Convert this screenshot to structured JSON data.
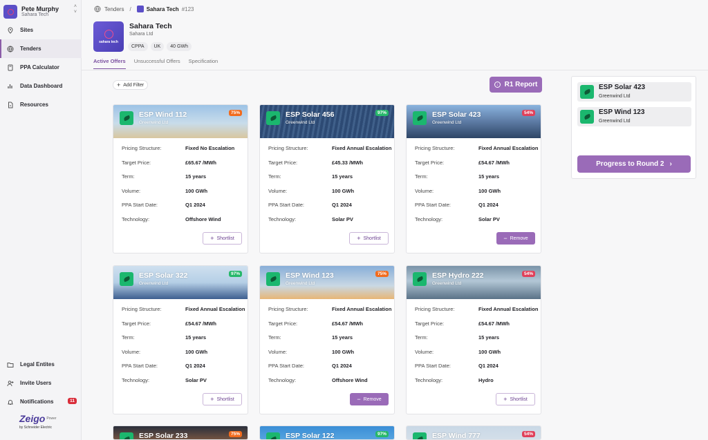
{
  "user": {
    "name": "Pete Murphy",
    "org": "Sahara Tech"
  },
  "nav": {
    "top": [
      {
        "label": "Sites",
        "icon": "pin-icon"
      },
      {
        "label": "Tenders",
        "icon": "globe-icon"
      },
      {
        "label": "PPA Calculator",
        "icon": "calculator-icon"
      },
      {
        "label": "Data Dashboard",
        "icon": "chart-icon"
      },
      {
        "label": "Resources",
        "icon": "document-icon"
      }
    ],
    "bottom": [
      {
        "label": "Legal Entites",
        "icon": "folder-icon"
      },
      {
        "label": "Invite Users",
        "icon": "user-plus-icon"
      },
      {
        "label": "Notifications",
        "icon": "bell-icon",
        "count": "11"
      }
    ]
  },
  "brand": {
    "name": "Zeigo",
    "suffix": "Power",
    "by": "by Schneider Electric"
  },
  "breadcrumb": {
    "root": "Tenders",
    "current": "Sahara Tech",
    "number": "#123"
  },
  "company": {
    "name": "Sahara Tech",
    "legal": "Sahara Ltd",
    "logo_text": "sahara tech",
    "tags": [
      "CPPA",
      "UK",
      "40 GWh"
    ]
  },
  "tabs": [
    "Active Offers",
    "Unsuccessful Offers",
    "Specification"
  ],
  "toolbar": {
    "add_filter": "Add Filter",
    "report": "R1 Report"
  },
  "labels": {
    "pricing": "Pricing Structure:",
    "target": "Target Price:",
    "term": "Term:",
    "volume": "Volume:",
    "start": "PPA Start Date:",
    "tech": "Technology:",
    "shortlist": "Shortlist",
    "remove": "Remove"
  },
  "offers": [
    {
      "title": "ESP Wind 112",
      "supplier": "Greenwind Ltd",
      "score": "75%",
      "pricing": "Fixed No Escalation",
      "price": "£65.67 /MWh",
      "term": "15 years",
      "volume": "100 GWh",
      "start": "Q1 2024",
      "tech": "Offshore Wind",
      "action": "Shortlist"
    },
    {
      "title": "ESP Solar 456",
      "supplier": "Greenwind Ltd",
      "score": "97%",
      "pricing": "Fixed Annual Escalation",
      "price": "£45.33 /MWh",
      "term": "15 years",
      "volume": "100 GWh",
      "start": "Q1 2024",
      "tech": "Solar PV",
      "action": "Shortlist"
    },
    {
      "title": "ESP Solar 423",
      "supplier": "Greenwind Ltd",
      "score": "54%",
      "pricing": "Fixed Annual Escalation",
      "price": "£54.67 /MWh",
      "term": "15 years",
      "volume": "100 GWh",
      "start": "Q1 2024",
      "tech": "Solar PV",
      "action": "Remove"
    },
    {
      "title": "ESP Solar 322",
      "supplier": "Greenwind Ltd",
      "score": "97%",
      "pricing": "Fixed Annual Escalation",
      "price": "£54.67 /MWh",
      "term": "15 years",
      "volume": "100 GWh",
      "start": "Q1 2024",
      "tech": "Solar PV",
      "action": "Shortlist"
    },
    {
      "title": "ESP Wind 123",
      "supplier": "Greenwind Ltd",
      "score": "75%",
      "pricing": "Fixed Annual Escalation",
      "price": "£54.67 /MWh",
      "term": "15 years",
      "volume": "100 GWh",
      "start": "Q1 2024",
      "tech": "Offshore Wind",
      "action": "Remove"
    },
    {
      "title": "ESP Hydro 222",
      "supplier": "Greenwind Ltd",
      "score": "54%",
      "pricing": "Fixed Annual Escalation",
      "price": "£54.67 /MWh",
      "term": "15 years",
      "volume": "100 GWh",
      "start": "Q1 2024",
      "tech": "Hydro",
      "action": "Shortlist"
    },
    {
      "title": "ESP Solar 233",
      "score": "75%"
    },
    {
      "title": "ESP Solar 122",
      "score": "97%"
    },
    {
      "title": "ESP Wind 777",
      "score": "54%"
    }
  ],
  "shortlist_panel": {
    "items": [
      {
        "title": "ESP Solar 423",
        "supplier": "Greenwind Ltd"
      },
      {
        "title": "ESP Wind 123",
        "supplier": "Greenwind Ltd"
      }
    ],
    "progress": "Progress to Round 2"
  },
  "colors": {
    "accent": "#9a6bb8",
    "badge_orange": "#f26b1d",
    "badge_green": "#27b86a",
    "badge_red": "#e0405a",
    "logo_green": "#1bb76e"
  }
}
